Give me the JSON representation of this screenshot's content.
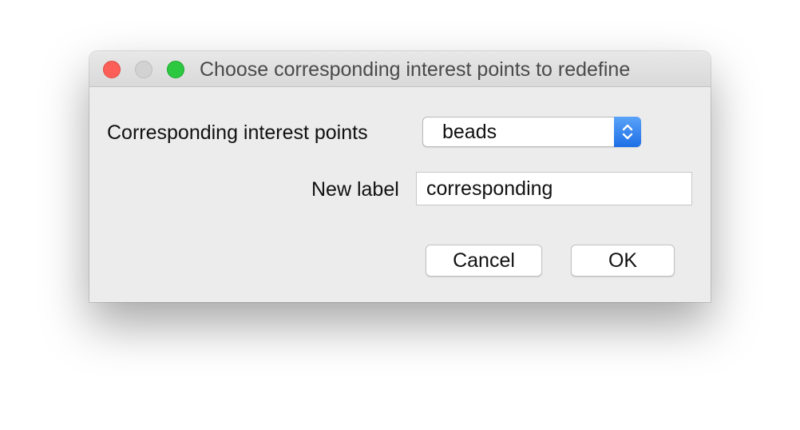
{
  "window": {
    "title": "Choose corresponding interest points to redefine"
  },
  "form": {
    "corresponding_label": "Corresponding interest points",
    "corresponding_selected": "beads",
    "new_label_label": "New label",
    "new_label_value": "corresponding"
  },
  "buttons": {
    "cancel_label": "Cancel",
    "ok_label": "OK"
  },
  "icons": {
    "close": "close-traffic-light-icon",
    "minimize": "minimize-traffic-light-icon",
    "zoom": "zoom-traffic-light-icon",
    "select_arrows": "chevron-up-down-icon"
  },
  "colors": {
    "close": "#fc5f57",
    "minimize": "#d2d2d2",
    "zoom": "#2bc840",
    "select_accent": "#2f7ff0"
  }
}
